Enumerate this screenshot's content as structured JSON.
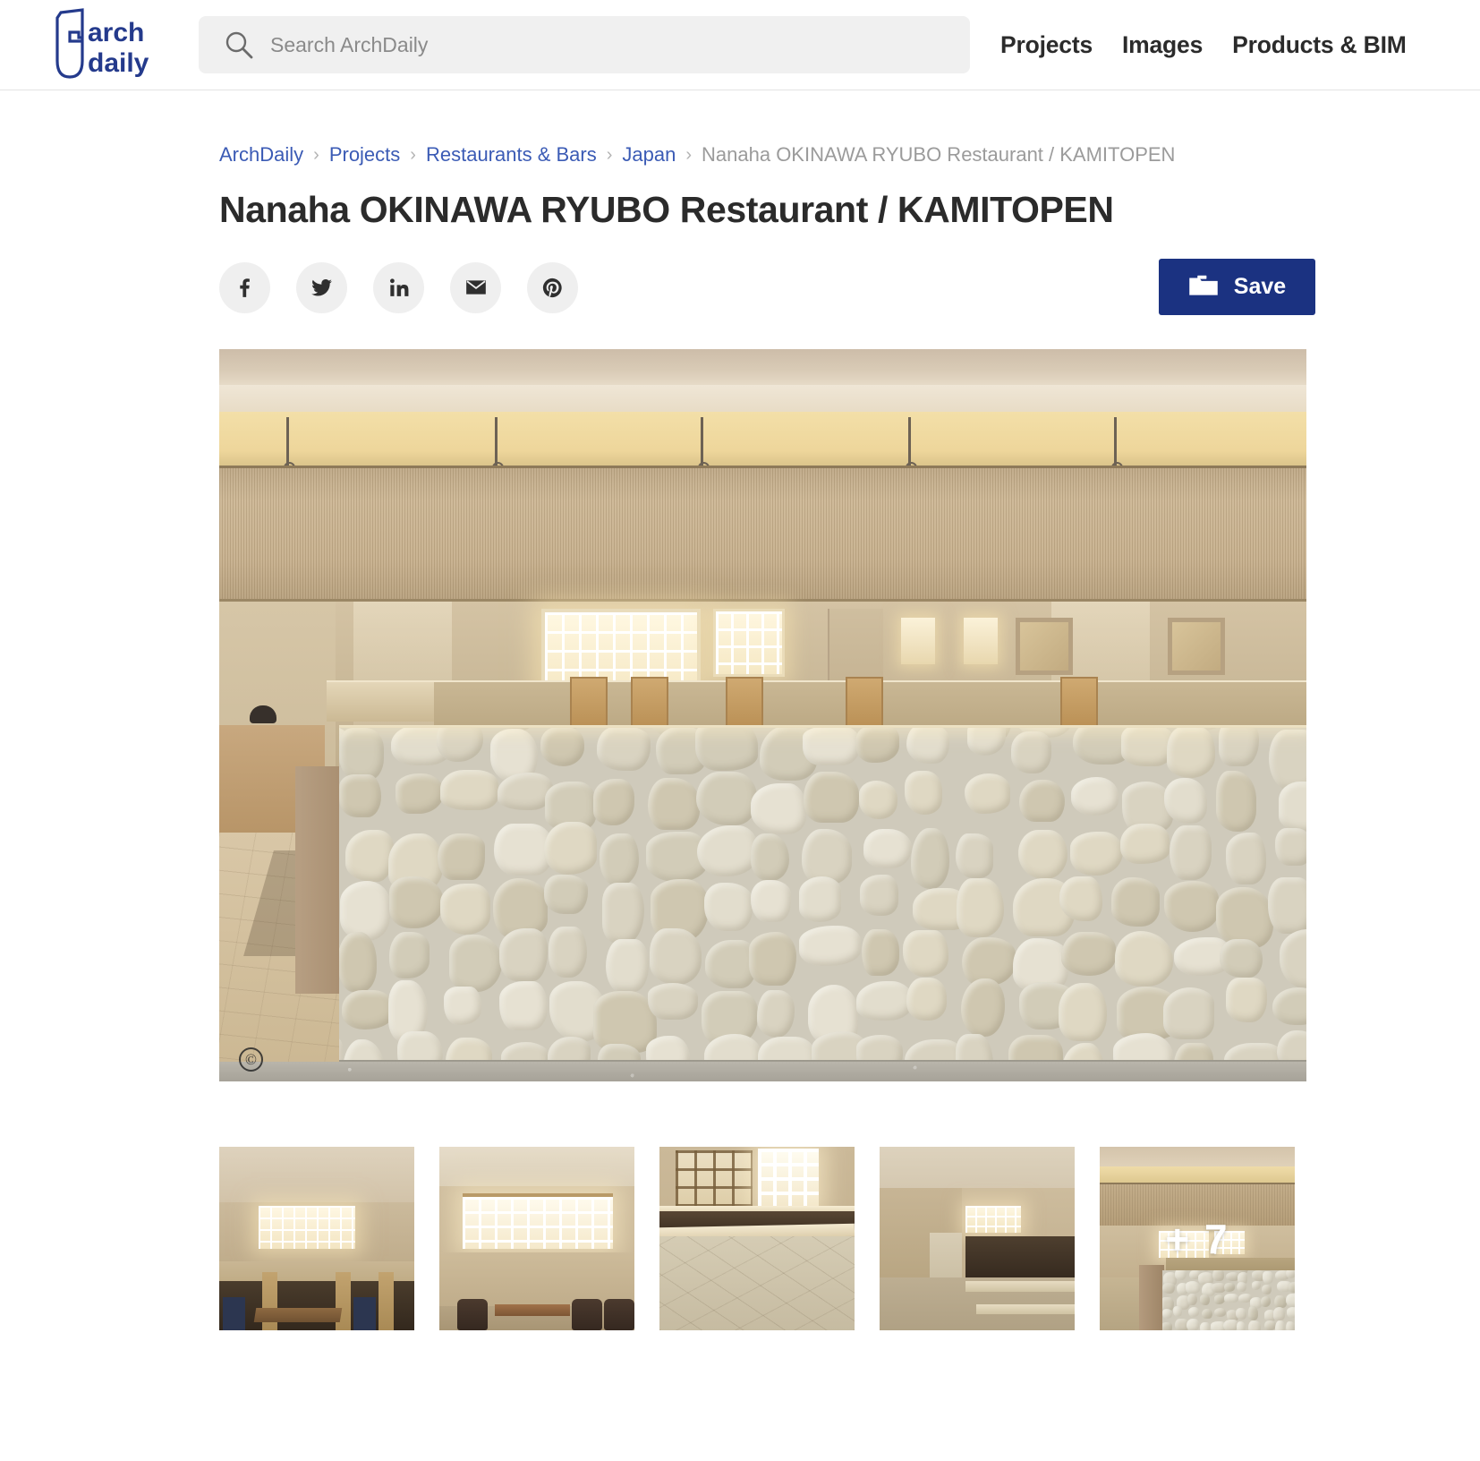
{
  "header": {
    "logo_alt": "ArchDaily",
    "logo_text_line1": "arch",
    "logo_text_line2": "daily",
    "search": {
      "placeholder": "Search ArchDaily",
      "value": "",
      "icon": "search-icon"
    },
    "nav": [
      {
        "label": "Projects"
      },
      {
        "label": "Images"
      },
      {
        "label": "Products & BIM"
      }
    ]
  },
  "breadcrumb": {
    "separator": "›",
    "items": [
      {
        "label": "ArchDaily",
        "current": false
      },
      {
        "label": "Projects",
        "current": false
      },
      {
        "label": "Restaurants & Bars",
        "current": false
      },
      {
        "label": "Japan",
        "current": false
      },
      {
        "label": "Nanaha OKINAWA RYUBO Restaurant / KAMITOPEN",
        "current": true
      }
    ]
  },
  "page": {
    "title": "Nanaha OKINAWA RYUBO Restaurant / KAMITOPEN"
  },
  "actions": {
    "share": [
      {
        "name": "facebook",
        "icon": "facebook-icon",
        "label": "Share on Facebook"
      },
      {
        "name": "twitter",
        "icon": "twitter-icon",
        "label": "Share on Twitter"
      },
      {
        "name": "linkedin",
        "icon": "linkedin-icon",
        "label": "Share on LinkedIn"
      },
      {
        "name": "email",
        "icon": "email-icon",
        "label": "Share by Email"
      },
      {
        "name": "pinterest",
        "icon": "pinterest-icon",
        "label": "Share on Pinterest"
      }
    ],
    "save": {
      "label": "Save",
      "icon": "folder-icon",
      "color": "#1b3281"
    }
  },
  "hero": {
    "alt": "Nanaha OKINAWA RYUBO Restaurant interior with Ryukyu limestone wall",
    "copyright_symbol": "©"
  },
  "gallery": {
    "thumbnails": [
      {
        "alt": "Dining area with lit lattice window and wooden booths"
      },
      {
        "alt": "Table seating with armchairs beside glass block wall"
      },
      {
        "alt": "Close-up of carved stone counter beneath lattice window"
      },
      {
        "alt": "Interior view of display shelving and corridor"
      },
      {
        "alt": "Overall view of restaurant with coral stone partition"
      }
    ],
    "more_count_label": "+ 7"
  },
  "colors": {
    "brand_blue": "#1b3281",
    "link_blue": "#3b5bb5",
    "text_dark": "#2b2b2b",
    "muted_gray": "#9b9b9b",
    "search_bg": "#f0f0f0",
    "share_bg": "#efefef"
  }
}
